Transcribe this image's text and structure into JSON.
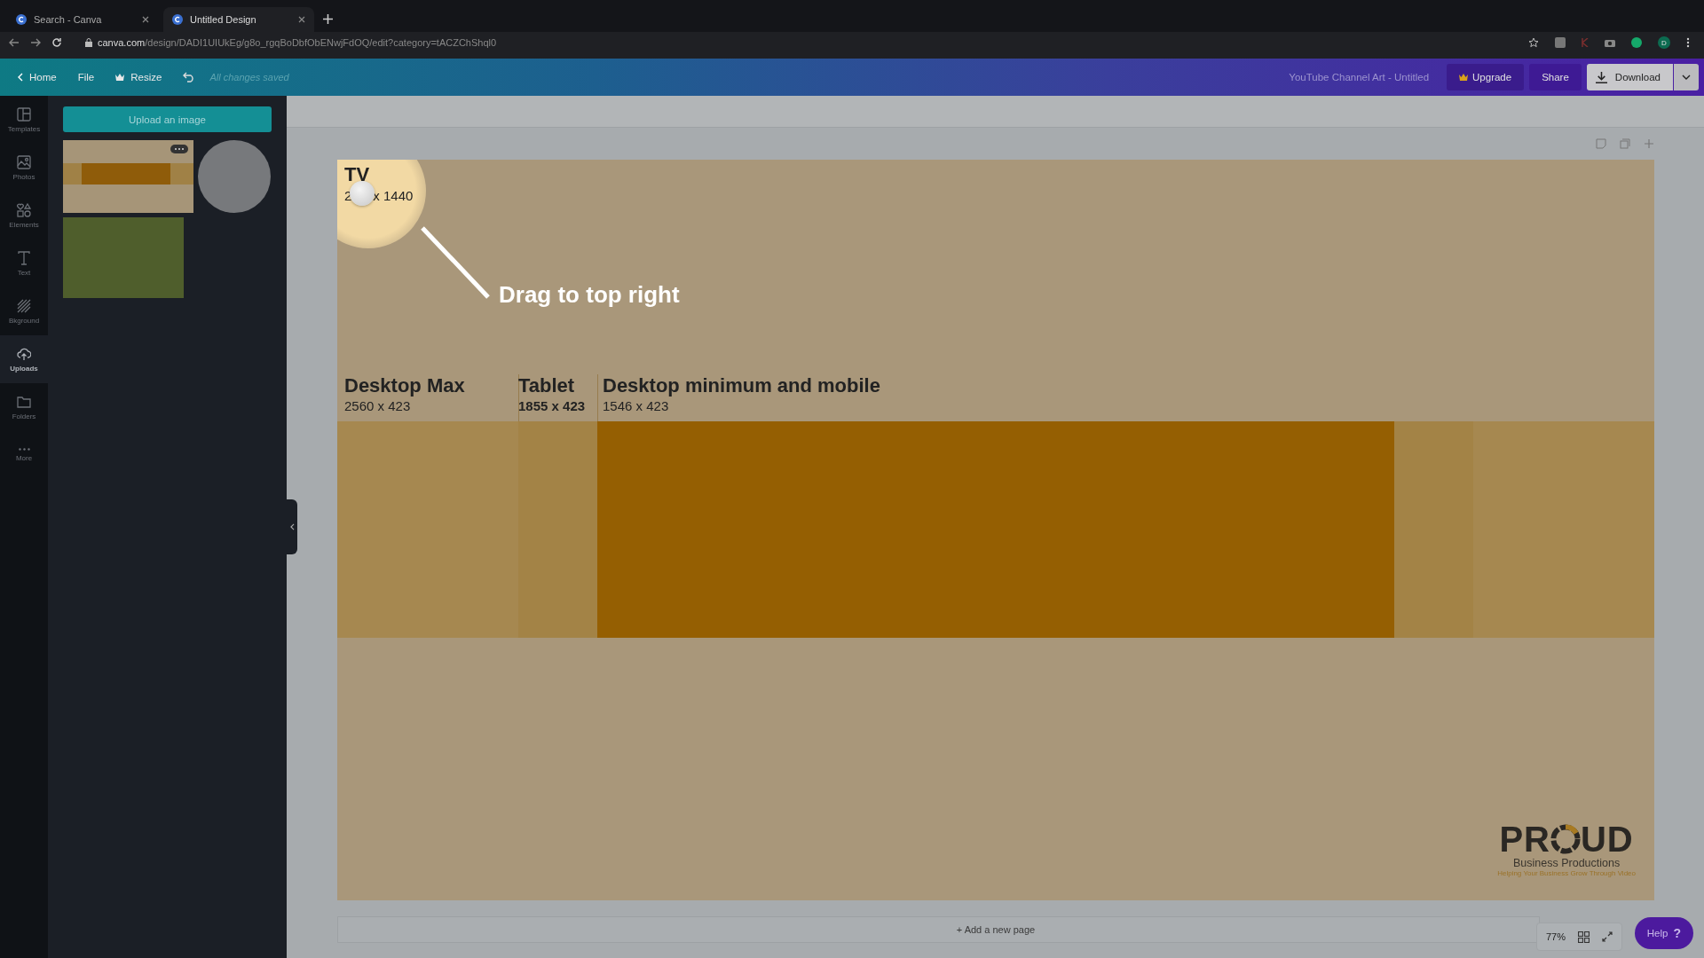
{
  "browser": {
    "tabs": [
      {
        "title": "Search - Canva",
        "selected": false
      },
      {
        "title": "Untitled Design",
        "selected": true
      }
    ],
    "url": {
      "host": "canva.com",
      "path": "/design/DADI1UIUkEg/g8o_rgqBoDbfObENwjFdOQ/edit?category=tACZChShql0"
    },
    "profile": "D"
  },
  "toolbar": {
    "nav": [
      {
        "label": "Home",
        "kind": "back"
      },
      {
        "label": "File",
        "kind": "plain"
      },
      {
        "label": "Resize",
        "kind": "crown"
      }
    ],
    "status": "All changes saved",
    "doc_title": "YouTube Channel Art - Untitled",
    "upgrade": "Upgrade",
    "share": "Share",
    "download": "Download"
  },
  "sidebar": {
    "items": [
      {
        "label": "Templates",
        "selected": false
      },
      {
        "label": "Photos",
        "selected": false
      },
      {
        "label": "Elements",
        "selected": false
      },
      {
        "label": "Text",
        "selected": false
      },
      {
        "label": "Bkground",
        "selected": false
      },
      {
        "label": "Uploads",
        "selected": true
      },
      {
        "label": "Folders",
        "selected": false
      },
      {
        "label": "More",
        "selected": false
      }
    ]
  },
  "uploads": {
    "button": "Upload an image"
  },
  "design": {
    "tv": {
      "title": "TV",
      "size_start": "2",
      "size_end": "x 1440"
    },
    "annotation": "Drag to top right",
    "sections": [
      {
        "title": "Desktop Max",
        "size": "2560 x 423"
      },
      {
        "title": "Tablet",
        "size": "1855 x 423"
      },
      {
        "title": "Desktop minimum and mobile",
        "size": "1546 x 423"
      }
    ],
    "logo": {
      "start": "PR",
      "end": "UD",
      "subtitle": "Business Productions",
      "tagline": "Helping Your Business Grow Through Video"
    }
  },
  "add_page": "+ Add a new page",
  "zoom": "77%",
  "help": {
    "label": "Help",
    "mark": "?"
  }
}
